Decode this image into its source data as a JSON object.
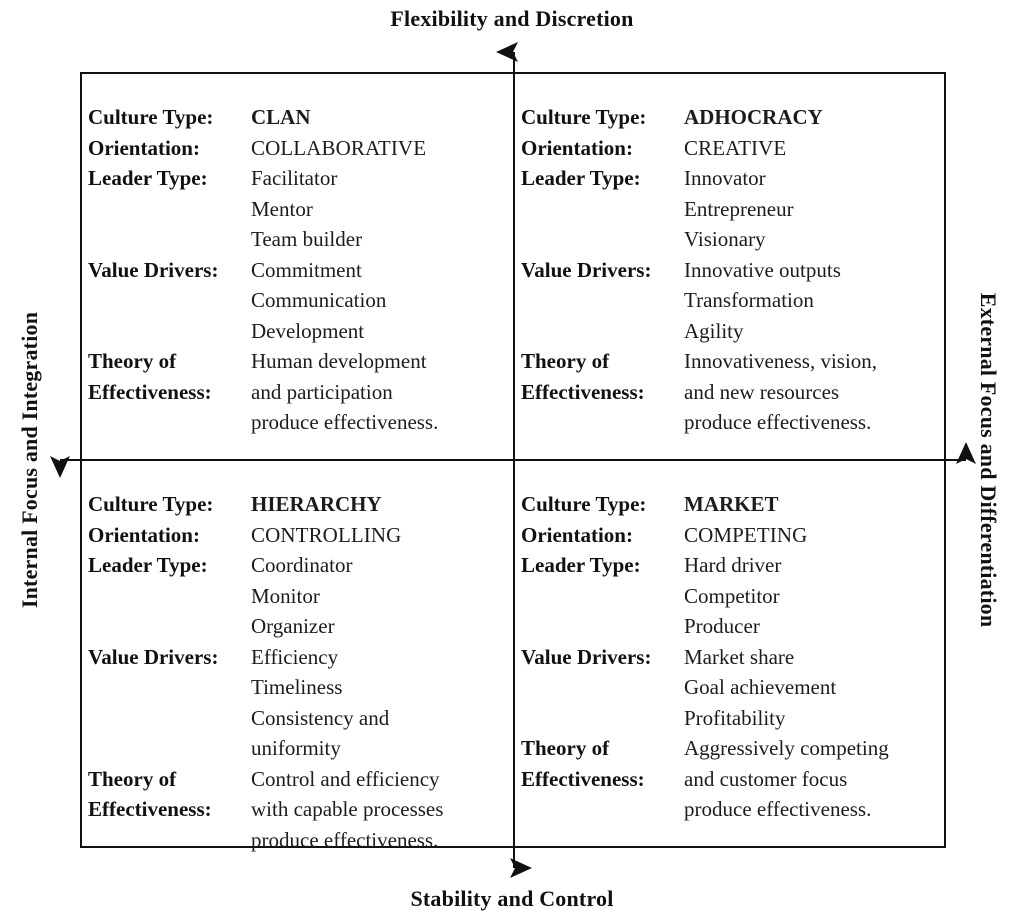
{
  "axes": {
    "top": "Flexibility and Discretion",
    "bottom": "Stability and Control",
    "left": "Internal Focus and Integration",
    "right": "External Focus and Differentiation"
  },
  "labels": {
    "culture_type": "Culture Type:",
    "orientation": "Orientation:",
    "leader_type": "Leader Type:",
    "value_drivers": "Value Drivers:",
    "theory_of_effectiveness": "Theory of\nEffectiveness:"
  },
  "quadrants": {
    "clan": {
      "culture_type": "CLAN",
      "orientation": "COLLABORATIVE",
      "leader_type": "Facilitator\nMentor\nTeam builder",
      "value_drivers": "Commitment\nCommunication\nDevelopment",
      "theory_of_effectiveness": "Human development\nand participation\nproduce effectiveness."
    },
    "adhocracy": {
      "culture_type": "ADHOCRACY",
      "orientation": "CREATIVE",
      "leader_type": "Innovator\nEntrepreneur\nVisionary",
      "value_drivers": "Innovative outputs\nTransformation\nAgility",
      "theory_of_effectiveness": "Innovativeness, vision,\nand new resources\nproduce effectiveness."
    },
    "hierarchy": {
      "culture_type": "HIERARCHY",
      "orientation": "CONTROLLING",
      "leader_type": "Coordinator\nMonitor\nOrganizer",
      "value_drivers": "Efficiency\nTimeliness\nConsistency and\nuniformity",
      "theory_of_effectiveness": "Control and efficiency\nwith capable processes\nproduce effectiveness."
    },
    "market": {
      "culture_type": "MARKET",
      "orientation": "COMPETING",
      "leader_type": "Hard driver\nCompetitor\nProducer",
      "value_drivers": "Market share\nGoal achievement\nProfitability",
      "theory_of_effectiveness": "Aggressively competing\nand customer focus\nproduce effectiveness."
    }
  },
  "colors": {
    "line": "#111111",
    "text": "#1a1a1a",
    "background": "#ffffff"
  }
}
